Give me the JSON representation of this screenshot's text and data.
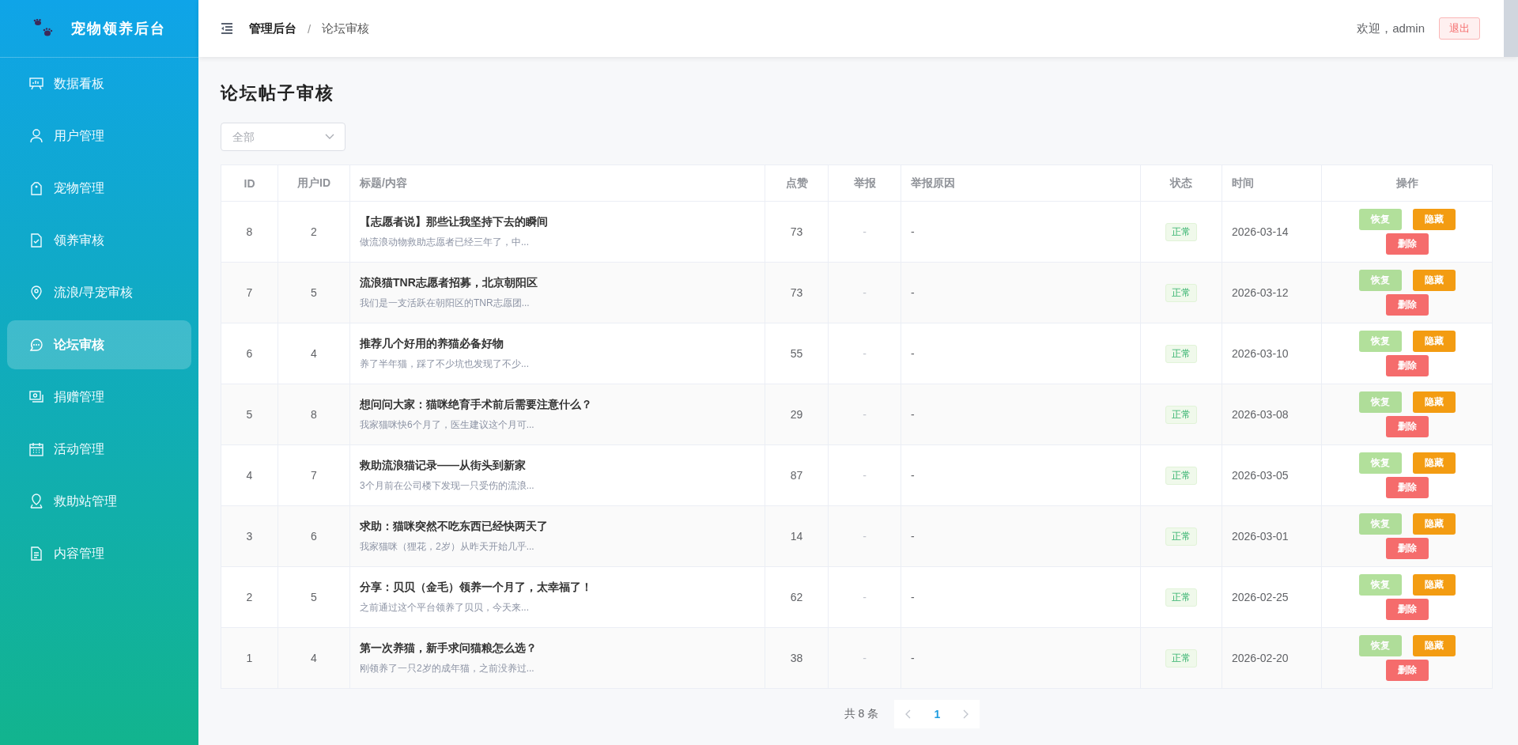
{
  "sidebar": {
    "title": "宠物领养后台",
    "items": [
      {
        "label": "数据看板",
        "selected": false
      },
      {
        "label": "用户管理",
        "selected": false
      },
      {
        "label": "宠物管理",
        "selected": false
      },
      {
        "label": "领养审核",
        "selected": false
      },
      {
        "label": "流浪/寻宠审核",
        "selected": false
      },
      {
        "label": "论坛审核",
        "selected": true
      },
      {
        "label": "捐赠管理",
        "selected": false
      },
      {
        "label": "活动管理",
        "selected": false
      },
      {
        "label": "救助站管理",
        "selected": false
      },
      {
        "label": "内容管理",
        "selected": false
      }
    ]
  },
  "header": {
    "breadcrumb": [
      "管理后台",
      "论坛审核"
    ],
    "separator": "/",
    "welcome": "欢迎，admin",
    "logout": "退出"
  },
  "page_title": "论坛帖子审核",
  "filter": {
    "placeholder": "全部"
  },
  "table": {
    "columns": [
      "ID",
      "用户ID",
      "标题/内容",
      "点赞",
      "举报",
      "举报原因",
      "状态",
      "时间",
      "操作"
    ],
    "rows": [
      {
        "id": "8",
        "user_id": "2",
        "title": "【志愿者说】那些让我坚持下去的瞬间",
        "excerpt": "做流浪动物救助志愿者已经三年了，中...",
        "likes": "73",
        "reports": "-",
        "reason": "-",
        "status": "正常",
        "time": "2026-03-14",
        "actions": [
          {
            "label": "恢复",
            "kind": "restore",
            "disabled": true
          },
          {
            "label": "隐藏",
            "kind": "hide",
            "disabled": false
          },
          {
            "label": "删除",
            "kind": "delete",
            "disabled": false
          }
        ]
      },
      {
        "id": "7",
        "user_id": "5",
        "title": "流浪猫TNR志愿者招募，北京朝阳区",
        "excerpt": "我们是一支活跃在朝阳区的TNR志愿团...",
        "likes": "73",
        "reports": "-",
        "reason": "-",
        "status": "正常",
        "time": "2026-03-12",
        "actions": [
          {
            "label": "恢复",
            "kind": "restore",
            "disabled": true
          },
          {
            "label": "隐藏",
            "kind": "hide",
            "disabled": false
          },
          {
            "label": "删除",
            "kind": "delete",
            "disabled": false
          }
        ]
      },
      {
        "id": "6",
        "user_id": "4",
        "title": "推荐几个好用的养猫必备好物",
        "excerpt": "养了半年猫，踩了不少坑也发现了不少...",
        "likes": "55",
        "reports": "-",
        "reason": "-",
        "status": "正常",
        "time": "2026-03-10",
        "actions": [
          {
            "label": "恢复",
            "kind": "restore",
            "disabled": true
          },
          {
            "label": "隐藏",
            "kind": "hide",
            "disabled": false
          },
          {
            "label": "删除",
            "kind": "delete",
            "disabled": false
          }
        ]
      },
      {
        "id": "5",
        "user_id": "8",
        "title": "想问问大家：猫咪绝育手术前后需要注意什么？",
        "excerpt": "我家猫咪快6个月了，医生建议这个月可...",
        "likes": "29",
        "reports": "-",
        "reason": "-",
        "status": "正常",
        "time": "2026-03-08",
        "actions": [
          {
            "label": "恢复",
            "kind": "restore",
            "disabled": true
          },
          {
            "label": "隐藏",
            "kind": "hide",
            "disabled": false
          },
          {
            "label": "删除",
            "kind": "delete",
            "disabled": false
          }
        ]
      },
      {
        "id": "4",
        "user_id": "7",
        "title": "救助流浪猫记录——从街头到新家",
        "excerpt": "3个月前在公司楼下发现一只受伤的流浪...",
        "likes": "87",
        "reports": "-",
        "reason": "-",
        "status": "正常",
        "time": "2026-03-05",
        "actions": [
          {
            "label": "恢复",
            "kind": "restore",
            "disabled": true
          },
          {
            "label": "隐藏",
            "kind": "hide",
            "disabled": false
          },
          {
            "label": "删除",
            "kind": "delete",
            "disabled": false
          }
        ]
      },
      {
        "id": "3",
        "user_id": "6",
        "title": "求助：猫咪突然不吃东西已经快两天了",
        "excerpt": "我家猫咪（狸花，2岁）从昨天开始几乎...",
        "likes": "14",
        "reports": "-",
        "reason": "-",
        "status": "正常",
        "time": "2026-03-01",
        "actions": [
          {
            "label": "恢复",
            "kind": "restore",
            "disabled": true
          },
          {
            "label": "隐藏",
            "kind": "hide",
            "disabled": false
          },
          {
            "label": "删除",
            "kind": "delete",
            "disabled": false
          }
        ]
      },
      {
        "id": "2",
        "user_id": "5",
        "title": "分享：贝贝（金毛）领养一个月了，太幸福了！",
        "excerpt": "之前通过这个平台领养了贝贝，今天来...",
        "likes": "62",
        "reports": "-",
        "reason": "-",
        "status": "正常",
        "time": "2026-02-25",
        "actions": [
          {
            "label": "恢复",
            "kind": "restore",
            "disabled": true
          },
          {
            "label": "隐藏",
            "kind": "hide",
            "disabled": false
          },
          {
            "label": "删除",
            "kind": "delete",
            "disabled": false
          }
        ]
      },
      {
        "id": "1",
        "user_id": "4",
        "title": "第一次养猫，新手求问猫粮怎么选？",
        "excerpt": "刚领养了一只2岁的成年猫，之前没养过...",
        "likes": "38",
        "reports": "-",
        "reason": "-",
        "status": "正常",
        "time": "2026-02-20",
        "actions": [
          {
            "label": "恢复",
            "kind": "restore",
            "disabled": true
          },
          {
            "label": "隐藏",
            "kind": "hide",
            "disabled": false
          },
          {
            "label": "删除",
            "kind": "delete",
            "disabled": false
          }
        ]
      }
    ]
  },
  "pagination": {
    "total": "共 8 条",
    "pages": [
      {
        "label": "1",
        "selected": true
      }
    ]
  }
}
